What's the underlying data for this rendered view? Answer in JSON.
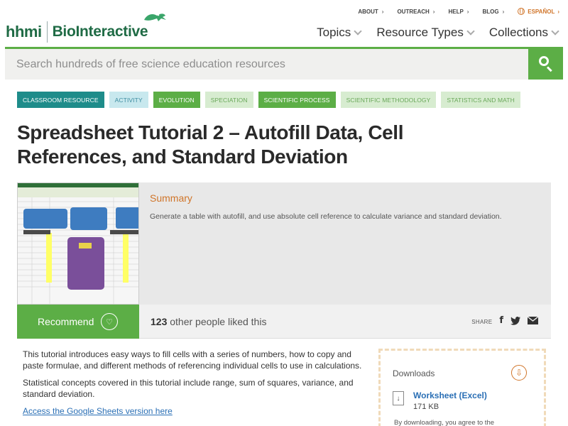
{
  "brand": {
    "hhmi": "hhmi",
    "name": "BioInteractive"
  },
  "topnav": [
    {
      "label": "ABOUT"
    },
    {
      "label": "OUTREACH"
    },
    {
      "label": "HELP"
    },
    {
      "label": "BLOG"
    }
  ],
  "language": {
    "label": "ESPAÑOL"
  },
  "mainnav": [
    {
      "label": "Topics"
    },
    {
      "label": "Resource Types"
    },
    {
      "label": "Collections"
    }
  ],
  "search": {
    "placeholder": "Search hundreds of free science education resources"
  },
  "tags": [
    {
      "label": "CLASSROOM RESOURCE",
      "style": "teal"
    },
    {
      "label": "ACTIVITY",
      "style": "lightblue"
    },
    {
      "label": "EVOLUTION",
      "style": "green"
    },
    {
      "label": "SPECIATION",
      "style": "lightgreen"
    },
    {
      "label": "SCIENTIFIC PROCESS",
      "style": "green"
    },
    {
      "label": "SCIENTIFIC METHODOLOGY",
      "style": "lightgreen"
    },
    {
      "label": "STATISTICS AND MATH",
      "style": "lightgreen"
    }
  ],
  "page": {
    "title_line1": "Spreadsheet Tutorial 2 – Autofill Data, Cell",
    "title_line2": "References, and Standard Deviation"
  },
  "summary": {
    "heading": "Summary",
    "text": "Generate a table with autofill, and use absolute cell reference to calculate variance and standard deviation."
  },
  "recommend": {
    "label": "Recommend",
    "count": "123",
    "liked_text": "other people liked this",
    "share_label": "SHARE"
  },
  "body": {
    "p1": "This tutorial introduces easy ways to fill cells with a series of numbers, how to copy and paste formulae, and different methods of referencing individual cells to use in calculations.",
    "p2": "Statistical concepts covered in this tutorial include range, sum of squares, variance, and standard deviation.",
    "link": "Access the Google Sheets version here"
  },
  "downloads": {
    "title": "Downloads",
    "file_name": "Worksheet (Excel)",
    "file_size": "171 KB",
    "note": "By downloading, you agree to the"
  },
  "colors": {
    "green": "#5cae46",
    "teal": "#1e8c8a",
    "orange": "#d0752a",
    "link": "#2a6fb5"
  }
}
